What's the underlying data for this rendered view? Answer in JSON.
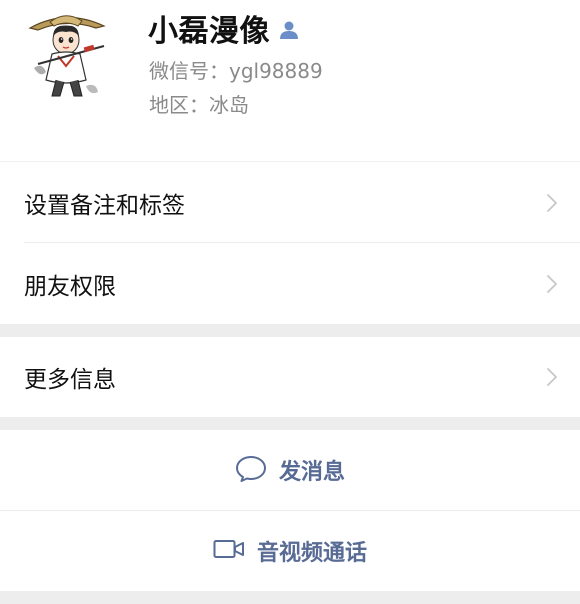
{
  "profile": {
    "name": "小磊漫像",
    "wechat_id": "微信号：ygl98889",
    "region": "地区：冰岛",
    "avatar_icon": "cartoon-avatar",
    "badge_icon": "person-icon"
  },
  "menu": {
    "remark_tags": "设置备注和标签",
    "friend_permissions": "朋友权限",
    "more_info": "更多信息"
  },
  "actions": {
    "send_message": "发消息",
    "video_call": "音视频通话"
  },
  "colors": {
    "background": "#ededed",
    "link_blue": "#576b95",
    "text": "#111111",
    "secondary_text": "#8a8a8a"
  }
}
